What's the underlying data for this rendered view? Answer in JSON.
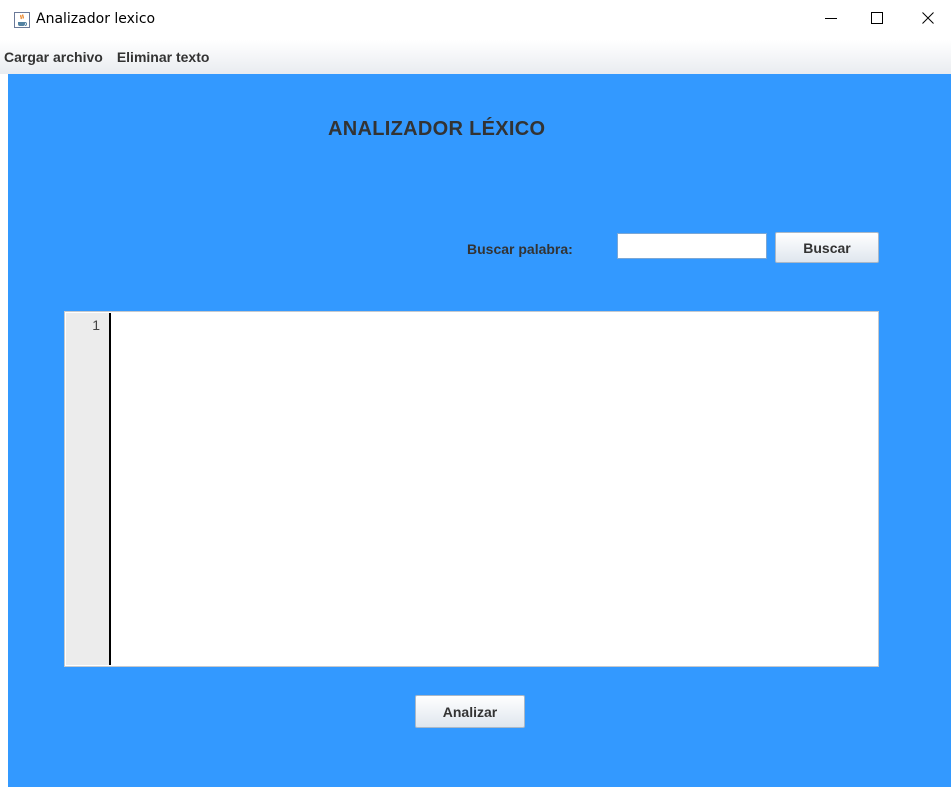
{
  "window": {
    "title": "Analizador lexico",
    "icon": "java-coffee-icon",
    "controls": {
      "minimize": "minimize-icon",
      "maximize": "maximize-icon",
      "close": "close-icon"
    }
  },
  "menubar": {
    "items": [
      {
        "label": "Cargar archivo"
      },
      {
        "label": "Eliminar texto"
      }
    ]
  },
  "main": {
    "heading": "ANALIZADOR LÉXICO",
    "search": {
      "label": "Buscar palabra:",
      "value": "",
      "button_label": "Buscar"
    },
    "editor": {
      "line_numbers": [
        "1"
      ],
      "content": ""
    },
    "analyze_button_label": "Analizar"
  },
  "colors": {
    "panel_background": "#3399ff",
    "text": "#333333"
  }
}
